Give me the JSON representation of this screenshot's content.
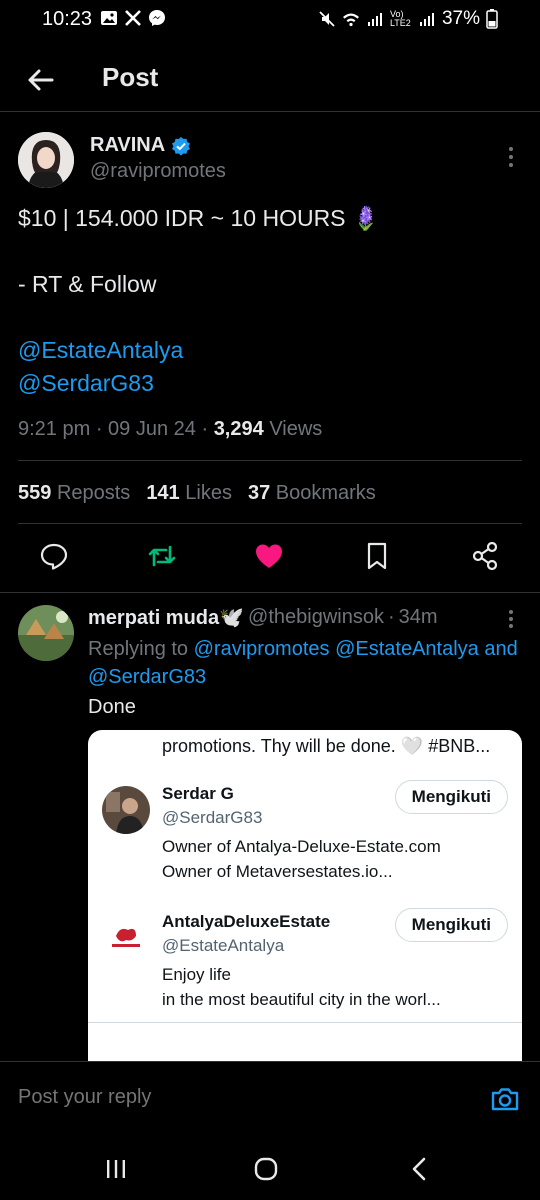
{
  "status_bar": {
    "time": "10:23",
    "battery": "37%",
    "left_icons": [
      "image-icon",
      "x-icon",
      "messenger-icon"
    ],
    "right_icons": [
      "mute-icon",
      "wifi-icon",
      "signal-icon",
      "volte-icon",
      "signal-icon",
      "battery-icon"
    ],
    "volte_label": "Vo) LTE2"
  },
  "header": {
    "title": "Post",
    "back_icon": "arrow-left-icon"
  },
  "post": {
    "author_name": "RAVINA",
    "verified": true,
    "handle": "@ravipromotes",
    "lines": [
      "$10 | 154.000 IDR ~ 10 HOURS 🪻",
      "",
      "- RT & Follow",
      "",
      "@EstateAntalya",
      "@SerdarG83"
    ],
    "time": "9:21 pm",
    "date": "09 Jun 24",
    "views_count": "3,294",
    "views_label": "Views",
    "reposts_count": "559",
    "reposts_label": "Reposts",
    "likes_count": "141",
    "likes_label": "Likes",
    "bookmarks_count": "37",
    "bookmarks_label": "Bookmarks",
    "actions": [
      "reply-icon",
      "repost-icon",
      "like-icon",
      "bookmark-icon",
      "share-icon"
    ],
    "colors": {
      "repost_active": "#00ba7c",
      "like_active": "#f91880",
      "link": "#1d9bf0"
    }
  },
  "reply": {
    "name": "merpati muda🕊️",
    "handle": "@thebigwinsok",
    "age": "34m",
    "replying_prefix": "Replying to",
    "mention1": "@ravipromotes",
    "mention2": "@EstateAntalya",
    "and_text": "and",
    "mention3": "@SerdarG83",
    "text": "Done",
    "card": {
      "top_text": "promotions. Thy will be done. 🤍 #BNB...",
      "users": [
        {
          "name": "Serdar G",
          "handle": "@SerdarG83",
          "bio_1": "Owner of Antalya-Deluxe-Estate.com",
          "bio_2": "Owner of Metaversestates.io...",
          "button": "Mengikuti"
        },
        {
          "name": "AntalyaDeluxeEstate",
          "handle": "@EstateAntalya",
          "bio_1": "Enjoy life",
          "bio_2": "in the most beautiful city in the worl...",
          "button": "Mengikuti"
        }
      ]
    }
  },
  "composer": {
    "placeholder": "Post your reply",
    "camera_icon": "camera-icon"
  },
  "nav": {
    "buttons": [
      "recent-apps-icon",
      "home-icon",
      "back-icon"
    ]
  }
}
